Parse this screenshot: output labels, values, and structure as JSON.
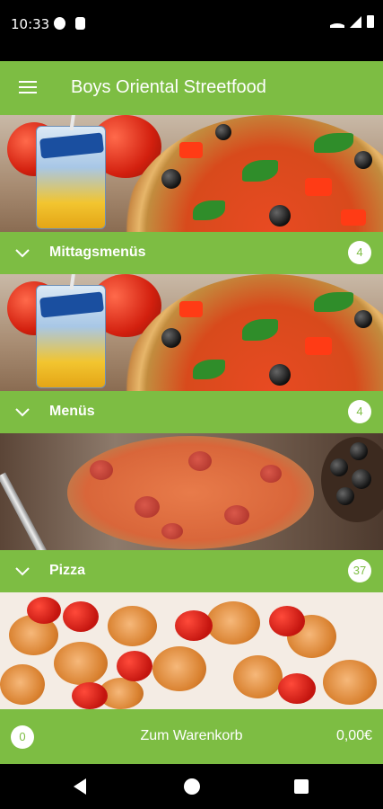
{
  "status": {
    "time": "10:33"
  },
  "appbar": {
    "title": "Boys Oriental Streetfood"
  },
  "categories": [
    {
      "label": "Mittagsmenüs",
      "count": "4"
    },
    {
      "label": "Menüs",
      "count": "4"
    },
    {
      "label": "Pizza",
      "count": "37"
    }
  ],
  "cart": {
    "count": "0",
    "label": "Zum Warenkorb",
    "total": "0,00€"
  },
  "colors": {
    "accent": "#7dbd43"
  },
  "icons": [
    "menu-icon",
    "chevron-down-icon",
    "back-icon",
    "home-icon",
    "recents-icon"
  ]
}
